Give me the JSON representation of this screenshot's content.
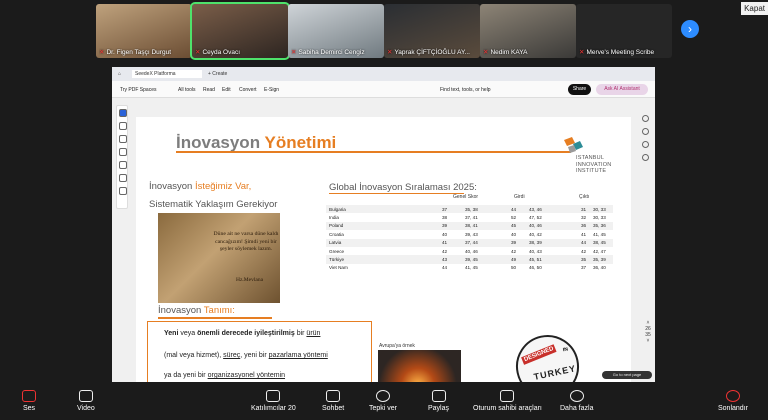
{
  "top_bar": {
    "close_label": "Kapat"
  },
  "participants": [
    {
      "name": "Dr. Figen Taşçı Durgut",
      "muted": true
    },
    {
      "name": "Ceyda Ovacı",
      "muted": true
    },
    {
      "name": "Sabiha Demirci Cengiz",
      "muted": true
    },
    {
      "name": "Yaprak ÇİFTÇİOĞLU AY...",
      "muted": true
    },
    {
      "name": "Nedim KAYA",
      "muted": true
    },
    {
      "name": "Merve's Meeting Scribe",
      "muted": true
    }
  ],
  "browser": {
    "tab_label": "SeedeX Platforma",
    "new_tab_label": "+ Create"
  },
  "pdf_toolbar": {
    "items": [
      "Try PDF Spaces",
      "All tools",
      "Read",
      "Edit",
      "Convert",
      "E-Sign"
    ],
    "search": "Find text, tools, or help",
    "share": "Share",
    "ai": "Ask AI Assistant"
  },
  "slide": {
    "title_a": "İnovasyon ",
    "title_b": "Yönetimi",
    "logo_lines": [
      "ISTANBUL",
      "INNOVATION",
      "INSTITUTE"
    ],
    "sub1_a": "İnovasyon ",
    "sub1_b": "İsteğimiz Var,",
    "sub2": "Sistematik Yaklaşım Gerekiyor",
    "quote": "Düne ait ne varsa düne kaldı cancağızım! Şimdi yeni bir şeyler söylemek lazım.",
    "signature": "Hz.Mevlana",
    "tanim_a": "İnovasyon ",
    "tanim_b": "Tanımı:",
    "def1_a": "Yeni",
    "def1_b": " veya ",
    "def1_c": "önemli derecede iyileştirilmiş",
    "def1_d": " bir ",
    "def1_e": "ürün",
    "def2_a": "(mal veya hizmet), ",
    "def2_b": "süreç",
    "def2_c": ", yeni bir ",
    "def2_d": "pazarlama yöntemi",
    "def3_a": "ya da yeni bir ",
    "def3_b": "organizasyonel yöntemin",
    "global_a": "Global ",
    "global_b": "İnovasyon Sıralaması 2025:",
    "col_genel": "Genel Skor",
    "col_girdi": "Girdi",
    "col_cikti": "Çıktı",
    "rows": [
      [
        "Bulgaria",
        "37",
        "35, 38",
        "44",
        "43, 46",
        "31",
        "30, 33"
      ],
      [
        "India",
        "38",
        "37, 41",
        "52",
        "47, 52",
        "32",
        "30, 33"
      ],
      [
        "Poland",
        "39",
        "38, 41",
        "45",
        "40, 46",
        "36",
        "35, 36"
      ],
      [
        "Croatia",
        "40",
        "39, 43",
        "40",
        "40, 42",
        "41",
        "41, 45"
      ],
      [
        "Latvia",
        "41",
        "37, 44",
        "39",
        "38, 39",
        "44",
        "38, 45"
      ],
      [
        "Greece",
        "42",
        "40, 46",
        "42",
        "40, 43",
        "42",
        "42, 47"
      ],
      [
        "Türkiye",
        "43",
        "39, 45",
        "49",
        "45, 51",
        "35",
        "35, 39"
      ],
      [
        "Viet Nam",
        "44",
        "41, 45",
        "50",
        "46, 50",
        "37",
        "36, 40"
      ]
    ],
    "avrupa": "Avrupa'ya örnek",
    "stamp_top": "DESIGNED",
    "stamp_in": "IN",
    "stamp_bottom": "TURKEY"
  },
  "page_nav": {
    "current": "26",
    "total": "35"
  },
  "bubble": "Go to next page",
  "bottom_bar": {
    "audio": "Ses",
    "video": "Video",
    "participants": "Katılımcılar",
    "participant_count": "20",
    "chat": "Sohbet",
    "react": "Tepki ver",
    "share": "Paylaş",
    "host_tools": "Oturum sahibi araçları",
    "more": "Daha fazla",
    "end": "Sonlandır"
  }
}
